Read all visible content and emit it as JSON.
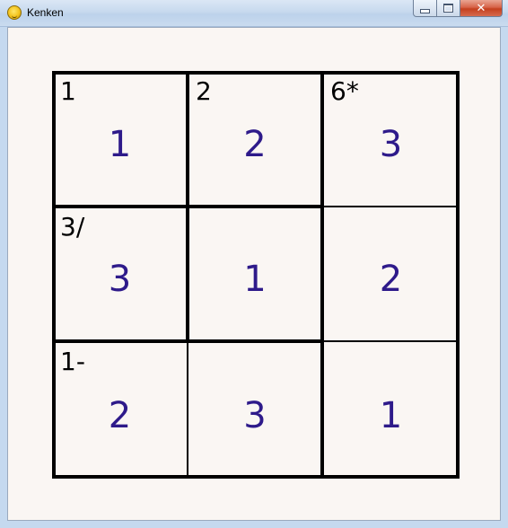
{
  "window": {
    "title": "Kenken",
    "icon": "python-icon",
    "controls": [
      "minimize",
      "maximize",
      "close"
    ]
  },
  "board": {
    "size": 3,
    "cells": [
      {
        "row": 0,
        "col": 0,
        "value": "1",
        "cage_label": "1"
      },
      {
        "row": 0,
        "col": 1,
        "value": "2",
        "cage_label": "2"
      },
      {
        "row": 0,
        "col": 2,
        "value": "3",
        "cage_label": "6*"
      },
      {
        "row": 1,
        "col": 0,
        "value": "3",
        "cage_label": "3/"
      },
      {
        "row": 1,
        "col": 1,
        "value": "1",
        "cage_label": ""
      },
      {
        "row": 1,
        "col": 2,
        "value": "2",
        "cage_label": ""
      },
      {
        "row": 2,
        "col": 0,
        "value": "2",
        "cage_label": "1-"
      },
      {
        "row": 2,
        "col": 1,
        "value": "3",
        "cage_label": ""
      },
      {
        "row": 2,
        "col": 2,
        "value": "1",
        "cage_label": ""
      }
    ],
    "colors": {
      "value_text": "#2e1a8a",
      "label_text": "#000000",
      "background": "#faf6f3"
    }
  }
}
